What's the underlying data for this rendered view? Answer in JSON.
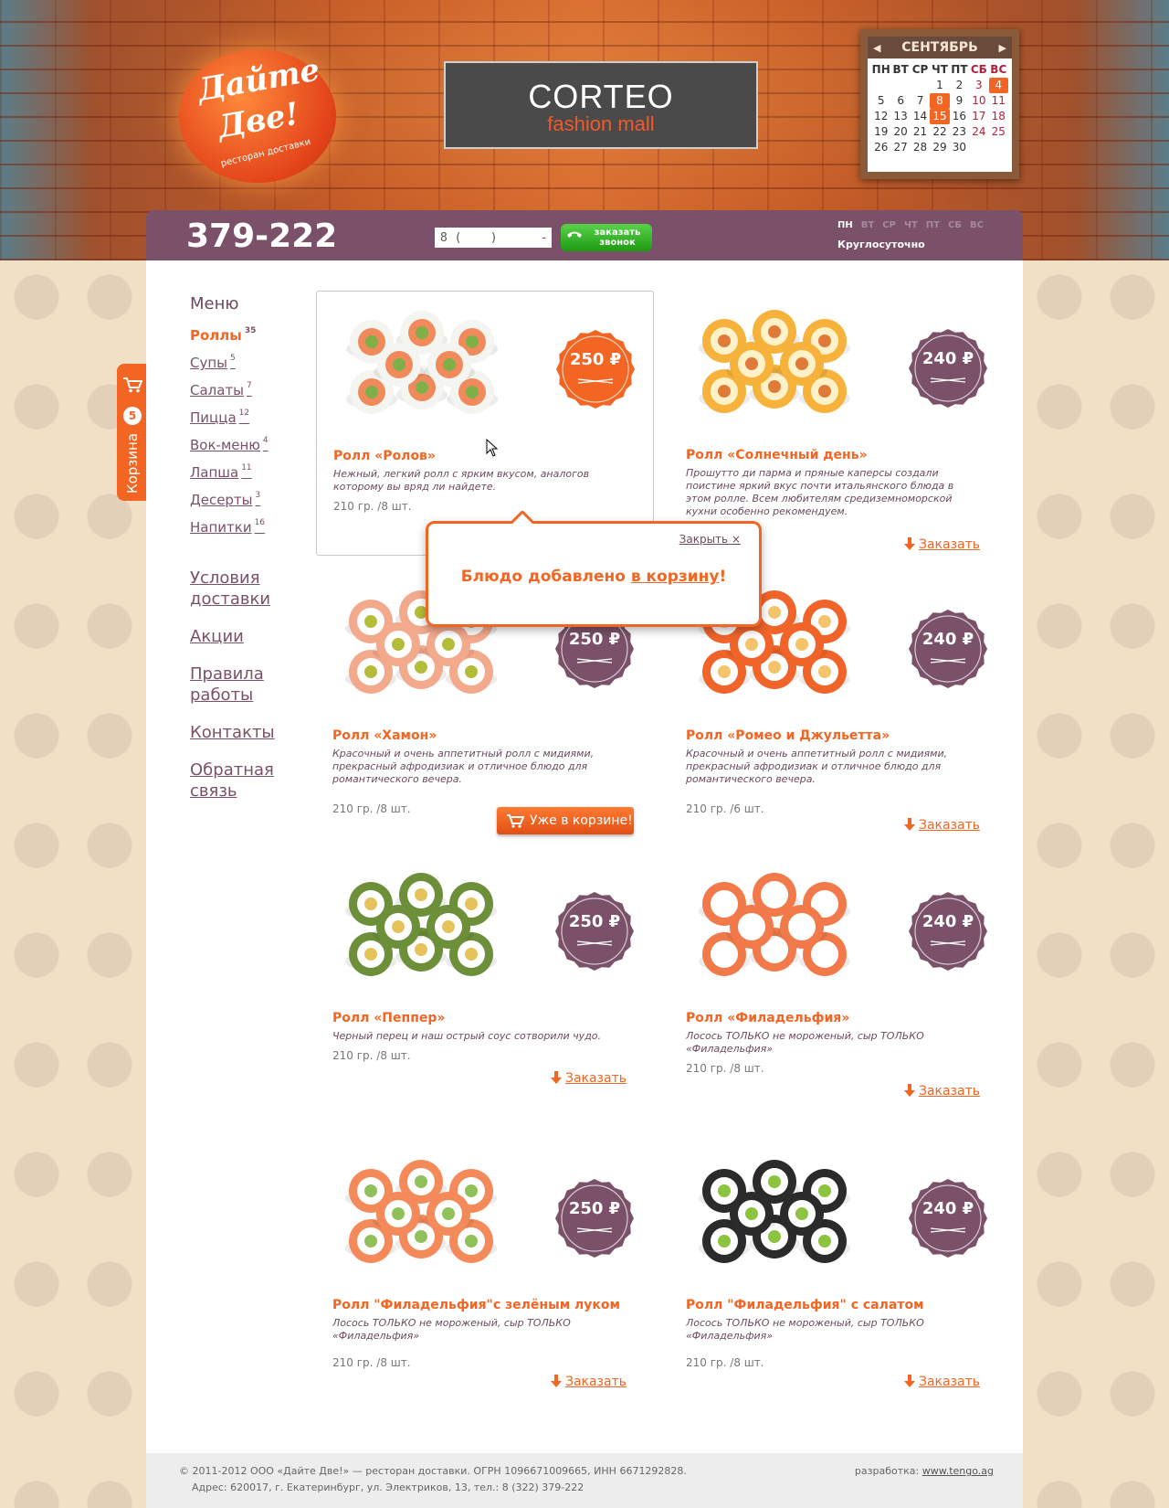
{
  "logo": {
    "line1": "Дайте",
    "line2": "Две!",
    "tagline": "ресторан доставки"
  },
  "banner": {
    "brand": "CORTEO",
    "sub": "fashion mall"
  },
  "calendar": {
    "month": "СЕНТЯБРЬ",
    "weekdays": [
      "ПН",
      "ВТ",
      "СР",
      "ЧТ",
      "ПТ",
      "СБ",
      "ВС"
    ],
    "weeks": [
      [
        "",
        "",
        "",
        "1",
        "2",
        "3",
        "4"
      ],
      [
        "5",
        "6",
        "7",
        "8",
        "9",
        "10",
        "11"
      ],
      [
        "12",
        "13",
        "14",
        "15",
        "16",
        "17",
        "18"
      ],
      [
        "19",
        "20",
        "21",
        "22",
        "23",
        "24",
        "25"
      ],
      [
        "26",
        "27",
        "28",
        "29",
        "30",
        "",
        ""
      ]
    ],
    "highlighted": [
      "4",
      "8",
      "15"
    ]
  },
  "header": {
    "phone": "379-222",
    "call_input_value": "8 (    )      -    -",
    "call_button": "заказать звонок",
    "days": [
      "ПН",
      "ВТ",
      "СР",
      "ЧТ",
      "ПТ",
      "СБ",
      "ВС"
    ],
    "hours": "Круглосуточно"
  },
  "cart": {
    "label": "Корзина",
    "count": "5"
  },
  "sidebar": {
    "menu_heading": "Меню",
    "categories": [
      {
        "label": "Роллы",
        "count": "35"
      },
      {
        "label": "Супы",
        "count": "5"
      },
      {
        "label": "Салаты",
        "count": "7"
      },
      {
        "label": "Пицца",
        "count": "12"
      },
      {
        "label": "Вок-меню",
        "count": "4"
      },
      {
        "label": "Лапша",
        "count": "11"
      },
      {
        "label": "Десерты",
        "count": "3"
      },
      {
        "label": "Напитки",
        "count": "16"
      }
    ],
    "links": [
      "Условия доставки",
      "Акции",
      "Правила работы",
      "Контакты",
      "Обратная связь"
    ]
  },
  "products": [
    {
      "title": "Ролл «Ролов»",
      "desc": "Нежный, легкий ролл с ярким вкусом, аналогов которому вы вряд ли найдете.",
      "weight": "210 гр. /8 шт.",
      "price": "250 ₽",
      "action": ""
    },
    {
      "title": "Ролл «Солнечный день»",
      "desc": "Прошутто ди парма и пряные каперсы создали поистине яркий вкус почти итальянского блюда в этом ролле. Всем любителям средиземноморской кухни особенно рекомендуем.",
      "weight": "",
      "price": "240 ₽",
      "action": "Заказать"
    },
    {
      "title": "Ролл «Хамон»",
      "desc": "Красочный и очень аппетитный ролл с мидиями, прекрасный афродизиак и отличное блюдо для романтического вечера.",
      "weight": "210 гр. /8 шт.",
      "price": "250 ₽",
      "action": "Уже в корзине!"
    },
    {
      "title": "Ролл «Ромео и Джульетта»",
      "desc": "Красочный и очень аппетитный ролл с мидиями, прекрасный афродизиак и отличное блюдо для романтического вечера.",
      "weight": "210 гр. /6 шт.",
      "price": "240 ₽",
      "action": "Заказать"
    },
    {
      "title": "Ролл «Пеппер»",
      "desc": "Черный перец и наш острый соус сотворили чудо.",
      "weight": "210 гр. /8 шт.",
      "price": "250 ₽",
      "action": "Заказать"
    },
    {
      "title": "Ролл «Филадельфия»",
      "desc": "Лосось ТОЛЬКО не мороженый, сыр ТОЛЬКО «Филадельфия»",
      "weight": "210 гр. /8 шт.",
      "price": "240 ₽",
      "action": "Заказать"
    },
    {
      "title": "Ролл \"Филадельфия\"с зелёным луком",
      "desc": "Лосось ТОЛЬКО не мороженый, сыр ТОЛЬКО «Филадельфия»",
      "weight": "210 гр. /8 шт.",
      "price": "250 ₽",
      "action": "Заказать"
    },
    {
      "title": "Ролл \"Филадельфия\" с салатом",
      "desc": "Лосось ТОЛЬКО не мороженый, сыр ТОЛЬКО «Филадельфия»",
      "weight": "210 гр. /8 шт.",
      "price": "240 ₽",
      "action": "Заказать"
    }
  ],
  "popup": {
    "close": "Закрыть ×",
    "message_start": "Блюдо добавлено ",
    "message_link": "в корзину",
    "message_end": "!"
  },
  "footer": {
    "copyright": "© 2011-2012 ООО «Дайте Две!» — ресторан доставки. ОГРН 1096671009665, ИНН 6671292828.",
    "address": "Адрес: 620017, г. Екатеринбург, ул. Электриков, 13, тел.: 8 (322) 379-222",
    "dev_label": "разработка: ",
    "dev_link": "www.tengo.ag"
  },
  "colors": {
    "accent": "#f26522",
    "plum": "#7a5168",
    "green": "#2fb31f"
  },
  "icons": [
    "cart-icon",
    "phone-icon",
    "arrow-down-icon",
    "calendar-prev-icon",
    "calendar-next-icon",
    "mouse-cursor-icon"
  ]
}
